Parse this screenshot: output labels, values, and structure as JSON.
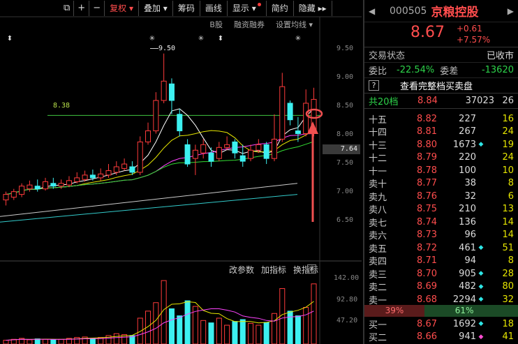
{
  "toolbar": {
    "items": [
      {
        "label": "复权",
        "active": true
      },
      {
        "label": "叠加"
      },
      {
        "label": "筹码"
      },
      {
        "label": "画线"
      },
      {
        "label": "显示"
      },
      {
        "label": "简约"
      },
      {
        "label": "隐藏"
      }
    ]
  },
  "subbar": [
    "B股",
    "融资融券",
    "设置均线"
  ],
  "price_axis": [
    "9.50",
    "9.00",
    "8.50",
    "8.00",
    "7.50",
    "7.00",
    "6.50"
  ],
  "current_price_tag": "7.64",
  "annotations": {
    "peak": "9.50",
    "hline": "8.38"
  },
  "indicator_bar": [
    "改参数",
    "加指标",
    "换指标"
  ],
  "volume_axis": [
    "142.00",
    "92.80",
    "47.20"
  ],
  "chart_data": {
    "type": "candlestick",
    "ylim": [
      6.2,
      9.9
    ],
    "hline": 8.38,
    "candles": [
      {
        "o": 6.85,
        "c": 6.95,
        "h": 7.0,
        "l": 6.75
      },
      {
        "o": 6.9,
        "c": 7.0,
        "h": 7.05,
        "l": 6.85
      },
      {
        "o": 6.95,
        "c": 7.1,
        "h": 7.15,
        "l": 6.9
      },
      {
        "o": 7.05,
        "c": 7.12,
        "h": 7.2,
        "l": 7.0
      },
      {
        "o": 7.1,
        "c": 7.05,
        "h": 7.22,
        "l": 7.0
      },
      {
        "o": 7.05,
        "c": 7.18,
        "h": 7.25,
        "l": 7.02
      },
      {
        "o": 7.15,
        "c": 7.1,
        "h": 7.25,
        "l": 7.05
      },
      {
        "o": 7.1,
        "c": 7.15,
        "h": 7.22,
        "l": 7.05
      },
      {
        "o": 7.12,
        "c": 7.2,
        "h": 7.28,
        "l": 7.08
      },
      {
        "o": 7.18,
        "c": 7.25,
        "h": 7.35,
        "l": 7.15
      },
      {
        "o": 7.22,
        "c": 7.3,
        "h": 7.38,
        "l": 7.18
      },
      {
        "o": 7.3,
        "c": 7.25,
        "h": 7.4,
        "l": 7.2
      },
      {
        "o": 7.25,
        "c": 7.32,
        "h": 7.42,
        "l": 7.2
      },
      {
        "o": 7.3,
        "c": 7.38,
        "h": 7.5,
        "l": 7.25
      },
      {
        "o": 7.35,
        "c": 7.45,
        "h": 7.55,
        "l": 7.3
      },
      {
        "o": 7.42,
        "c": 7.5,
        "h": 7.6,
        "l": 7.38
      },
      {
        "o": 7.45,
        "c": 7.35,
        "h": 7.55,
        "l": 7.3
      },
      {
        "o": 7.35,
        "c": 7.9,
        "h": 8.0,
        "l": 7.3
      },
      {
        "o": 7.9,
        "c": 8.1,
        "h": 8.25,
        "l": 7.85
      },
      {
        "o": 8.1,
        "c": 8.65,
        "h": 8.8,
        "l": 8.05
      },
      {
        "o": 8.65,
        "c": 9.0,
        "h": 9.5,
        "l": 8.6
      },
      {
        "o": 8.95,
        "c": 8.65,
        "h": 9.05,
        "l": 8.4
      },
      {
        "o": 8.4,
        "c": 8.1,
        "h": 8.5,
        "l": 8.0
      },
      {
        "o": 7.85,
        "c": 7.5,
        "h": 7.95,
        "l": 7.45
      },
      {
        "o": 7.6,
        "c": 7.75,
        "h": 7.85,
        "l": 7.3
      },
      {
        "o": 7.7,
        "c": 7.85,
        "h": 7.95,
        "l": 7.6
      },
      {
        "o": 7.7,
        "c": 7.55,
        "h": 7.8,
        "l": 7.45
      },
      {
        "o": 7.6,
        "c": 7.8,
        "h": 7.9,
        "l": 7.55
      },
      {
        "o": 7.8,
        "c": 7.85,
        "h": 8.0,
        "l": 7.75
      },
      {
        "o": 7.9,
        "c": 7.7,
        "h": 7.95,
        "l": 7.6
      },
      {
        "o": 7.65,
        "c": 7.55,
        "h": 7.85,
        "l": 7.45
      },
      {
        "o": 7.6,
        "c": 7.75,
        "h": 7.85,
        "l": 7.55
      },
      {
        "o": 7.75,
        "c": 7.85,
        "h": 7.95,
        "l": 7.7
      },
      {
        "o": 7.85,
        "c": 7.6,
        "h": 7.9,
        "l": 7.5
      },
      {
        "o": 7.6,
        "c": 7.95,
        "h": 8.4,
        "l": 7.55
      },
      {
        "o": 7.95,
        "c": 8.9,
        "h": 9.15,
        "l": 7.9
      },
      {
        "o": 8.6,
        "c": 8.3,
        "h": 8.65,
        "l": 8.2
      },
      {
        "o": 8.1,
        "c": 8.05,
        "h": 8.35,
        "l": 7.9
      },
      {
        "o": 8.05,
        "c": 8.6,
        "h": 8.85,
        "l": 8.0
      },
      {
        "o": 8.1,
        "c": 8.67,
        "h": 8.88,
        "l": 8.0
      }
    ],
    "volumes": [
      8,
      10,
      12,
      9,
      11,
      10,
      9,
      10,
      12,
      14,
      15,
      12,
      14,
      18,
      22,
      20,
      18,
      55,
      70,
      88,
      135,
      75,
      60,
      92,
      80,
      50,
      45,
      55,
      40,
      48,
      52,
      44,
      40,
      46,
      65,
      118,
      70,
      60,
      78,
      128
    ],
    "vol_ylim": [
      0,
      150
    ]
  },
  "right": {
    "code": "000505",
    "name": "京粮控股",
    "price": "8.67",
    "change": "+0.61",
    "change_pct": "+7.57%",
    "status_label": "交易状态",
    "status_value": "已收市",
    "ratio_label": "委比",
    "ratio_value": "-22.54%",
    "diff_label": "委差",
    "diff_value": "-13620",
    "full_book": "查看完整档买卖盘",
    "total": {
      "label": "共20档",
      "price": "8.84",
      "vol": "37023",
      "count": "26"
    },
    "asks": [
      {
        "lbl": "十五",
        "p": "8.82",
        "v": "227",
        "mk": "",
        "c": "16"
      },
      {
        "lbl": "十四",
        "p": "8.81",
        "v": "267",
        "mk": "",
        "c": "24"
      },
      {
        "lbl": "十三",
        "p": "8.80",
        "v": "1673",
        "mk": "◆",
        "c": "19"
      },
      {
        "lbl": "十二",
        "p": "8.79",
        "v": "220",
        "mk": "",
        "c": "24"
      },
      {
        "lbl": "十一",
        "p": "8.78",
        "v": "100",
        "mk": "",
        "c": "10"
      },
      {
        "lbl": "卖十",
        "p": "8.77",
        "v": "38",
        "mk": "",
        "c": "8"
      },
      {
        "lbl": "卖九",
        "p": "8.76",
        "v": "32",
        "mk": "",
        "c": "6"
      },
      {
        "lbl": "卖八",
        "p": "8.75",
        "v": "210",
        "mk": "",
        "c": "13"
      },
      {
        "lbl": "卖七",
        "p": "8.74",
        "v": "136",
        "mk": "",
        "c": "14"
      },
      {
        "lbl": "卖六",
        "p": "8.73",
        "v": "96",
        "mk": "",
        "c": "14"
      },
      {
        "lbl": "卖五",
        "p": "8.72",
        "v": "461",
        "mk": "◆",
        "c": "51"
      },
      {
        "lbl": "卖四",
        "p": "8.71",
        "v": "94",
        "mk": "",
        "c": "8"
      },
      {
        "lbl": "卖三",
        "p": "8.70",
        "v": "905",
        "mk": "◆",
        "c": "28"
      },
      {
        "lbl": "卖二",
        "p": "8.69",
        "v": "482",
        "mk": "◆",
        "c": "80"
      },
      {
        "lbl": "卖一",
        "p": "8.68",
        "v": "2294",
        "mk": "◆",
        "c": "32"
      }
    ],
    "split": {
      "buy": "39%",
      "sell": "61%"
    },
    "bids": [
      {
        "lbl": "买一",
        "p": "8.67",
        "v": "1692",
        "mk": "◆",
        "c": "18"
      },
      {
        "lbl": "买二",
        "p": "8.66",
        "v": "941",
        "mk": "◆p",
        "c": "41"
      }
    ]
  }
}
